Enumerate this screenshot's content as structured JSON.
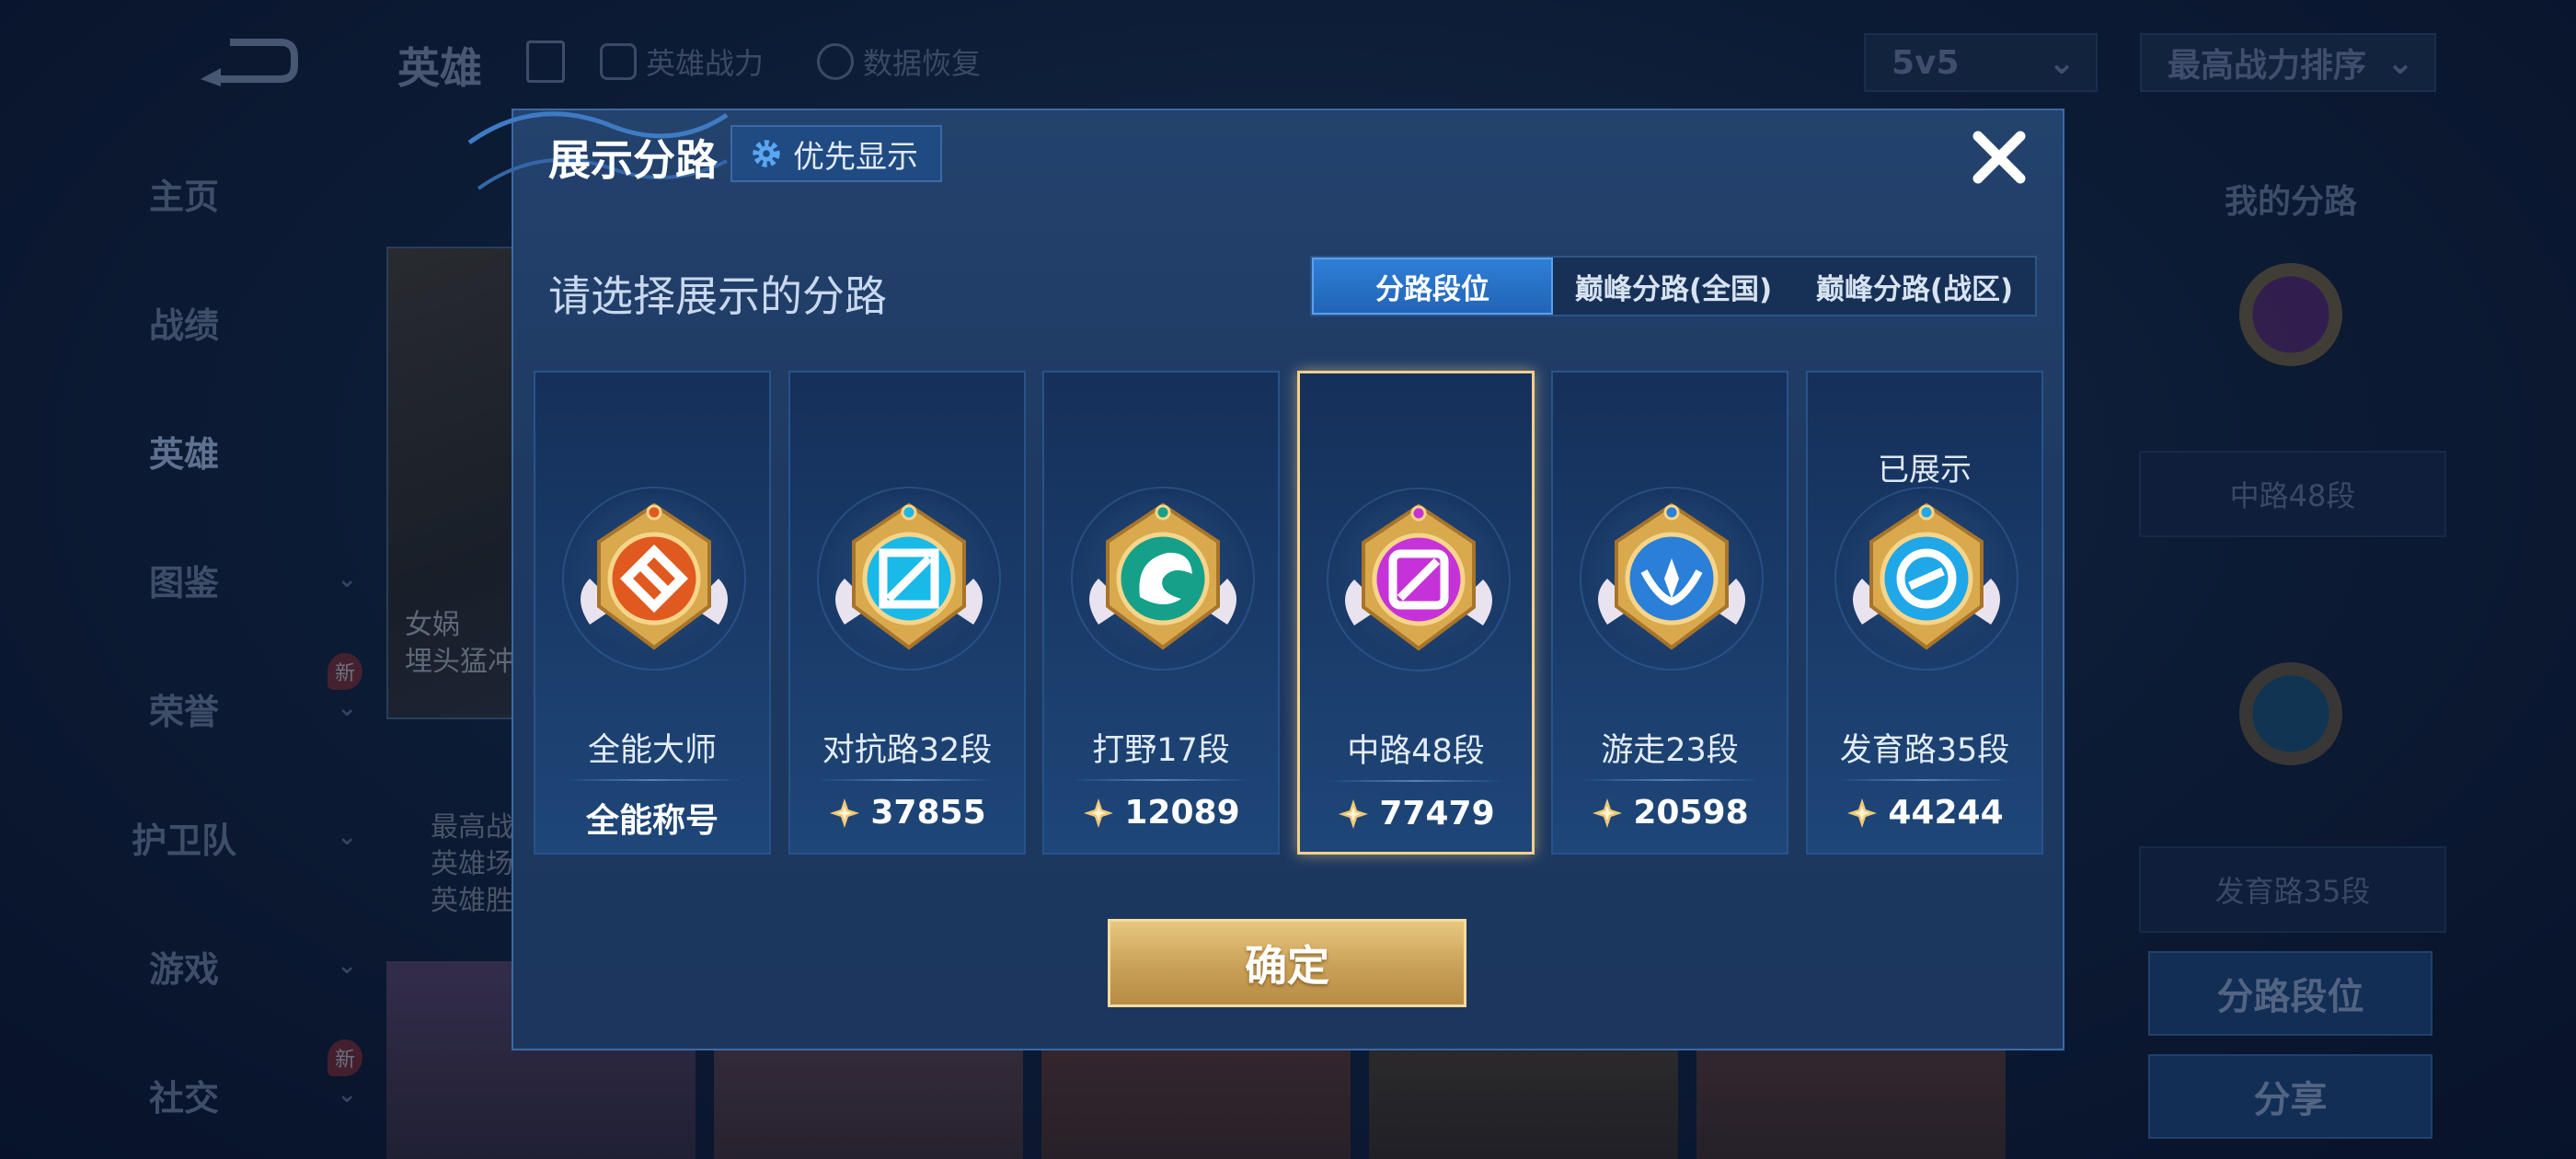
{
  "background": {
    "top_title": "英雄",
    "top_links": [
      "英雄战力",
      "数据恢复"
    ],
    "mode_dropdown": "5v5",
    "sort_dropdown": "最高战力排序",
    "sidebar": [
      {
        "label": "主页",
        "chevron": false,
        "new": false
      },
      {
        "label": "战绩",
        "chevron": false,
        "new": false
      },
      {
        "label": "英雄",
        "chevron": false,
        "new": false,
        "active": true
      },
      {
        "label": "图鉴",
        "chevron": true,
        "new": false
      },
      {
        "label": "荣誉",
        "chevron": true,
        "new": true
      },
      {
        "label": "护卫队",
        "chevron": true,
        "new": false
      },
      {
        "label": "游戏",
        "chevron": true,
        "new": false
      },
      {
        "label": "社交",
        "chevron": true,
        "new": true
      }
    ],
    "new_badge": "新",
    "hero_name_lines": [
      "女娲",
      "埋头猛冲"
    ],
    "hero_stat_lines": [
      "最高战",
      "英雄场",
      "英雄胜"
    ],
    "right_panel": {
      "title": "我的分路",
      "box1": "中路48段",
      "box2": "发育路35段",
      "btn1": "分路段位",
      "btn2": "分享"
    }
  },
  "modal": {
    "title": "展示分路",
    "priority_button": "优先显示",
    "subtitle": "请选择展示的分路",
    "tabs": [
      {
        "label": "分路段位",
        "active": true
      },
      {
        "label": "巅峰分路(全国)",
        "active": false
      },
      {
        "label": "巅峰分路(战区)",
        "active": false
      }
    ],
    "cards": [
      {
        "name": "全能大师",
        "score": "全能称号",
        "has_star": false,
        "medal": "allround",
        "color": "#e0591f",
        "selected": false,
        "shown": ""
      },
      {
        "name": "对抗路32段",
        "score": "37855",
        "has_star": true,
        "medal": "clash",
        "color": "#19b9e8",
        "selected": false,
        "shown": ""
      },
      {
        "name": "打野17段",
        "score": "12089",
        "has_star": true,
        "medal": "jungle",
        "color": "#15a089",
        "selected": false,
        "shown": ""
      },
      {
        "name": "中路48段",
        "score": "77479",
        "has_star": true,
        "medal": "mid",
        "color": "#c533d8",
        "selected": true,
        "shown": ""
      },
      {
        "name": "游走23段",
        "score": "20598",
        "has_star": true,
        "medal": "roam",
        "color": "#2a7fd8",
        "selected": false,
        "shown": ""
      },
      {
        "name": "发育路35段",
        "score": "44244",
        "has_star": true,
        "medal": "farm",
        "color": "#1fa7e8",
        "selected": false,
        "shown": "已展示"
      }
    ],
    "confirm_button": "确定"
  }
}
